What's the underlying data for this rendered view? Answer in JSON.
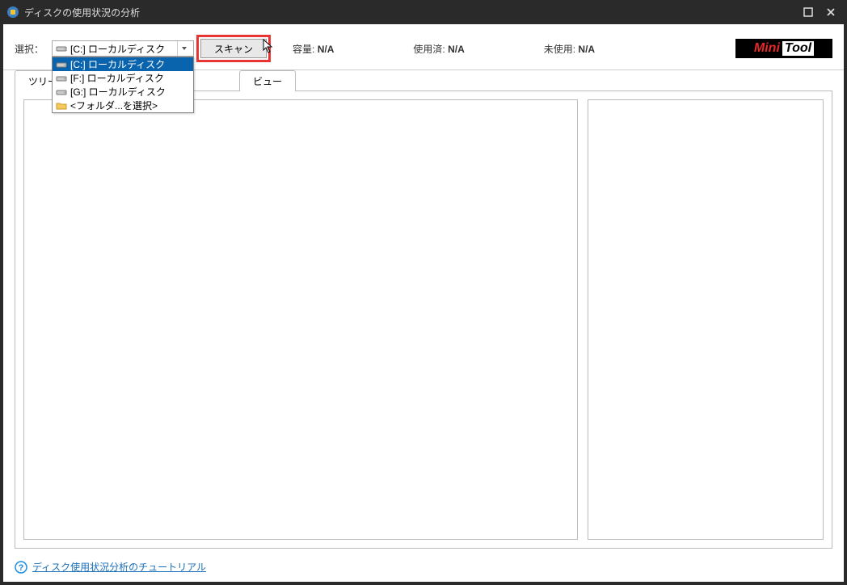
{
  "window": {
    "title": "ディスクの使用状況の分析"
  },
  "toolbar": {
    "select_label": "選択：",
    "selected_drive": "[C:] ローカルディスク",
    "scan_label": "スキャン",
    "capacity_label": "容量:",
    "capacity_value": "N/A",
    "used_label": "使用済:",
    "used_value": "N/A",
    "unused_label": "未使用:",
    "unused_value": "N/A",
    "logo_mini": "Mini",
    "logo_tool": "Tool"
  },
  "dropdown": {
    "items": [
      {
        "icon": "drive",
        "label": "[C:] ローカルディスク",
        "selected": true
      },
      {
        "icon": "drive",
        "label": "[F:] ローカルディスク",
        "selected": false
      },
      {
        "icon": "drive",
        "label": "[G:] ローカルディスク",
        "selected": false
      },
      {
        "icon": "folder",
        "label": "<フォルダ...を選択>",
        "selected": false
      }
    ]
  },
  "tabs": {
    "tab1": "ツリービュー",
    "tab2_partial": "ビュー"
  },
  "footer": {
    "tutorial_link": "ディスク使用状況分析のチュートリアル"
  }
}
